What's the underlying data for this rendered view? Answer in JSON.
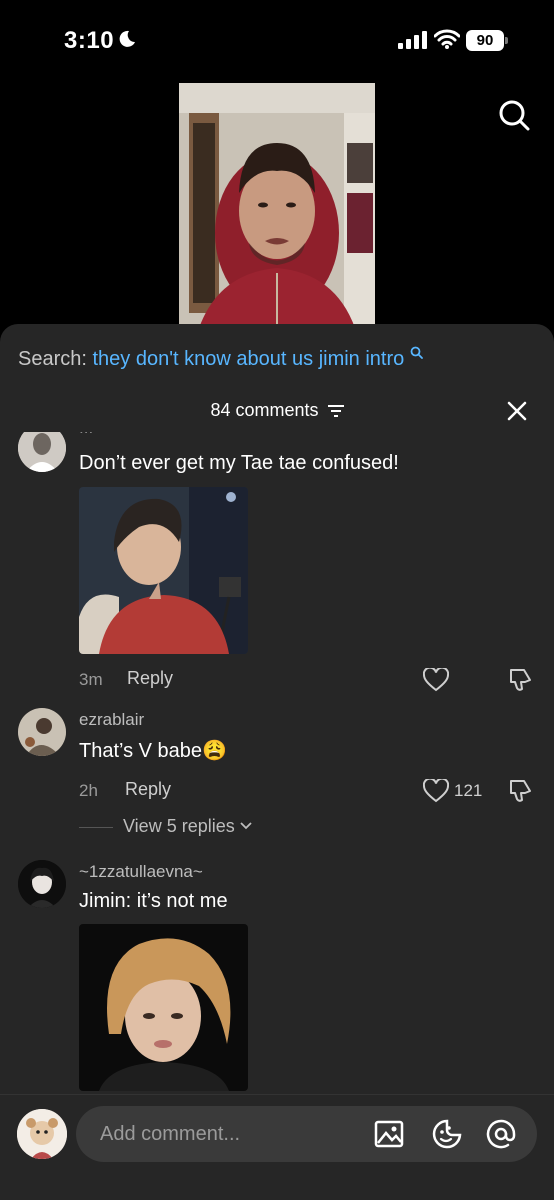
{
  "status_bar": {
    "time": "3:10",
    "battery": "90"
  },
  "search": {
    "label": "Search:",
    "query": "they don't know about us jimin intro"
  },
  "comments_header": {
    "count_label": "84 comments"
  },
  "comments": [
    {
      "username": "...",
      "text": "Don’t ever get my Tae tae confused!",
      "time": "3m",
      "reply_label": "Reply",
      "likes": ""
    },
    {
      "username": "ezrablair",
      "text": "That’s V babe😩",
      "time": "2h",
      "reply_label": "Reply",
      "likes": "121",
      "view_replies": "View 5 replies"
    },
    {
      "username": "~1zzatullaevna~",
      "text": "Jimin: it’s not me"
    }
  ],
  "composer": {
    "placeholder": "Add comment..."
  },
  "colors": {
    "sheet_bg": "#262626",
    "accent_blue": "#58b6ff"
  }
}
